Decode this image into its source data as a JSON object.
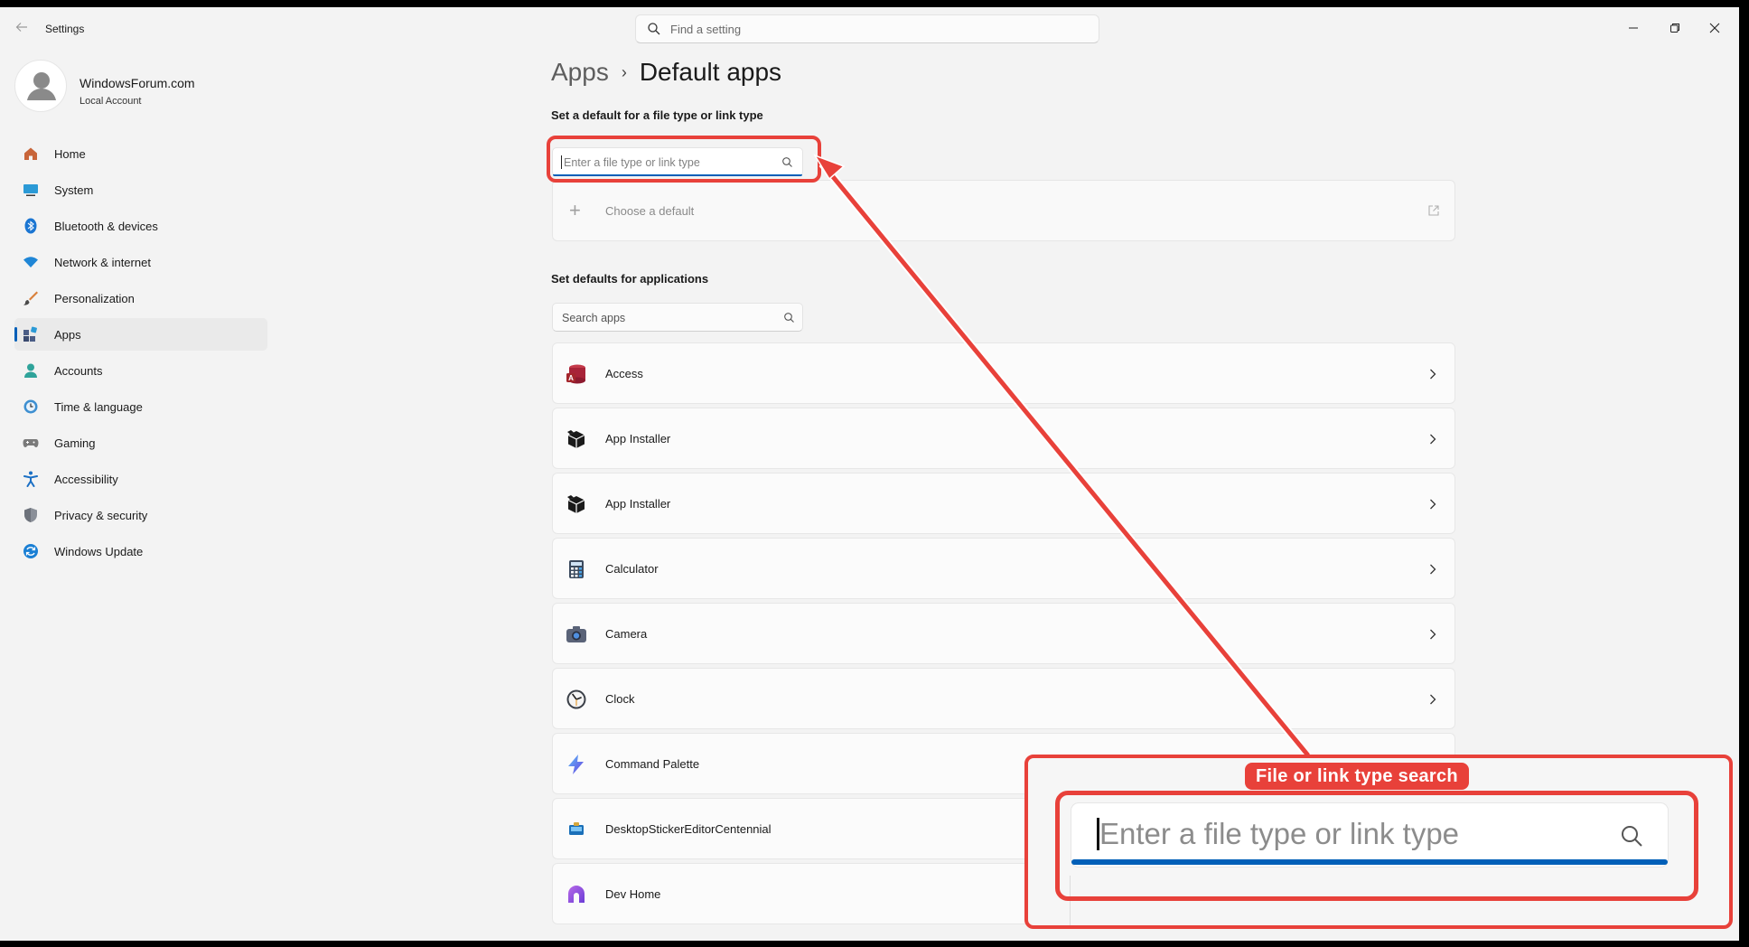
{
  "window": {
    "title": "Settings",
    "search_placeholder": "Find a setting"
  },
  "profile": {
    "name": "WindowsForum.com",
    "account_type": "Local Account"
  },
  "nav": {
    "items": [
      {
        "label": "Home",
        "icon": "home-icon",
        "active": false
      },
      {
        "label": "System",
        "icon": "system-icon",
        "active": false
      },
      {
        "label": "Bluetooth & devices",
        "icon": "bluetooth-icon",
        "active": false
      },
      {
        "label": "Network & internet",
        "icon": "wifi-icon",
        "active": false
      },
      {
        "label": "Personalization",
        "icon": "brush-icon",
        "active": false
      },
      {
        "label": "Apps",
        "icon": "apps-icon",
        "active": true
      },
      {
        "label": "Accounts",
        "icon": "accounts-icon",
        "active": false
      },
      {
        "label": "Time & language",
        "icon": "clock-globe-icon",
        "active": false
      },
      {
        "label": "Gaming",
        "icon": "gamepad-icon",
        "active": false
      },
      {
        "label": "Accessibility",
        "icon": "accessibility-icon",
        "active": false
      },
      {
        "label": "Privacy & security",
        "icon": "shield-icon",
        "active": false
      },
      {
        "label": "Windows Update",
        "icon": "update-icon",
        "active": false
      }
    ]
  },
  "breadcrumb": {
    "parent": "Apps",
    "separator": "›",
    "current": "Default apps"
  },
  "file_type_section": {
    "heading": "Set a default for a file type or link type",
    "input_placeholder": "Enter a file type or link type",
    "input_value": "",
    "choose_label": "Choose a default"
  },
  "apps_section": {
    "heading": "Set defaults for applications",
    "search_placeholder": "Search apps",
    "apps": [
      {
        "name": "Access",
        "icon": "access-icon"
      },
      {
        "name": "App Installer",
        "icon": "app-installer-icon"
      },
      {
        "name": "App Installer",
        "icon": "app-installer-icon"
      },
      {
        "name": "Calculator",
        "icon": "calculator-icon"
      },
      {
        "name": "Camera",
        "icon": "camera-icon"
      },
      {
        "name": "Clock",
        "icon": "clock-icon"
      },
      {
        "name": "Command Palette",
        "icon": "command-palette-icon"
      },
      {
        "name": "DesktopStickerEditorCentennial",
        "icon": "sticker-editor-icon"
      },
      {
        "name": "Dev Home",
        "icon": "dev-home-icon"
      }
    ]
  },
  "annotation": {
    "label": "File or link type search",
    "zoom_placeholder": "Enter a file type or link type",
    "color": "#e8413a"
  },
  "colors": {
    "accent": "#005fb8",
    "window_bg": "#f3f3f3"
  }
}
